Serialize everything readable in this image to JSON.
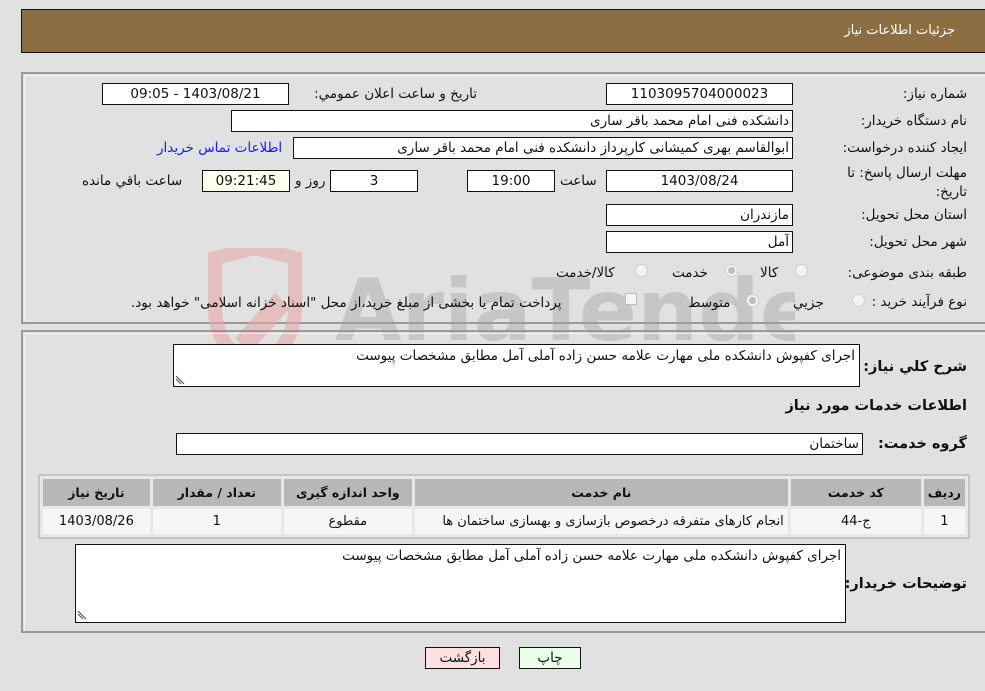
{
  "header": {
    "title": "جزئیات اطلاعات نیاز"
  },
  "form": {
    "need_number": {
      "label": "شماره نیاز:",
      "value": "1103095704000023"
    },
    "announce_datetime": {
      "label": "تاریخ و ساعت اعلان عمومي:",
      "value": "1403/08/21 - 09:05"
    },
    "buyer_org": {
      "label": "نام دستگاه خريدار:",
      "value": "دانشکده فنی امام محمد باقر ساری"
    },
    "requester": {
      "label": "ایجاد کننده درخواست:",
      "value": "ابوالقاسم بهری کمیشانی کارپرداز  دانشکده فنی امام محمد باقر ساری"
    },
    "buyer_contact_link": "اطلاعات تماس خریدار",
    "deadline": {
      "label": "مهلت ارسال پاسخ: تا تاریخ:",
      "date": "1403/08/24",
      "time_label": "ساعت",
      "time": "19:00",
      "days": "3",
      "days_label": "روز و",
      "remaining": "09:21:45",
      "remaining_label": "ساعت باقي مانده"
    },
    "province": {
      "label": "استان محل تحویل:",
      "value": "مازندران"
    },
    "city": {
      "label": "شهر محل تحویل:",
      "value": "آمل"
    },
    "category": {
      "label": "طبقه بندی موضوعی:",
      "options": [
        "کالا",
        "خدمت",
        "کالا/خدمت"
      ],
      "selected": "خدمت"
    },
    "purchase_type": {
      "label": "نوع فرآیند خرید :",
      "options": [
        "جزيي",
        "متوسط"
      ],
      "selected": "متوسط",
      "treasury_checkbox_label": "پرداخت تمام یا بخشی از مبلغ خرید،از محل \"اسناد خزانه اسلامی\" خواهد بود.",
      "treasury_checked": false
    }
  },
  "description": {
    "label": "شرح کلي نياز:",
    "value": "اجرای کفپوش دانشکده ملی مهارت علامه حسن زاده آملی آمل مطابق مشخصات پیوست"
  },
  "services": {
    "section_title": "اطلاعات خدمات مورد نیاز",
    "group_label": "گروه خدمت:",
    "group_value": "ساختمان",
    "table": {
      "headers": [
        "ردیف",
        "کد خدمت",
        "نام خدمت",
        "واحد اندازه گیری",
        "تعداد / مقدار",
        "تاریخ نیاز"
      ],
      "rows": [
        [
          "1",
          "ج-44",
          "انجام کارهای متفرقه درخصوص بازسازی و بهسازی ساختمان ها",
          "مقطوع",
          "1",
          "1403/08/26"
        ]
      ]
    }
  },
  "buyer_notes": {
    "label": "توضیحات خریدار:",
    "value": "اجرای کفپوش دانشکده ملی مهارت علامه حسن زاده آملی آمل مطابق مشخصات پیوست"
  },
  "buttons": {
    "print": "چاپ",
    "back": "بازگشت"
  },
  "watermark": {
    "text": "AriaTender.neT"
  },
  "colors": {
    "header_bg": "#8c6d41",
    "print_bg": "#eaffea",
    "back_bg": "#ffe0e0",
    "link": "#1a1aff"
  }
}
